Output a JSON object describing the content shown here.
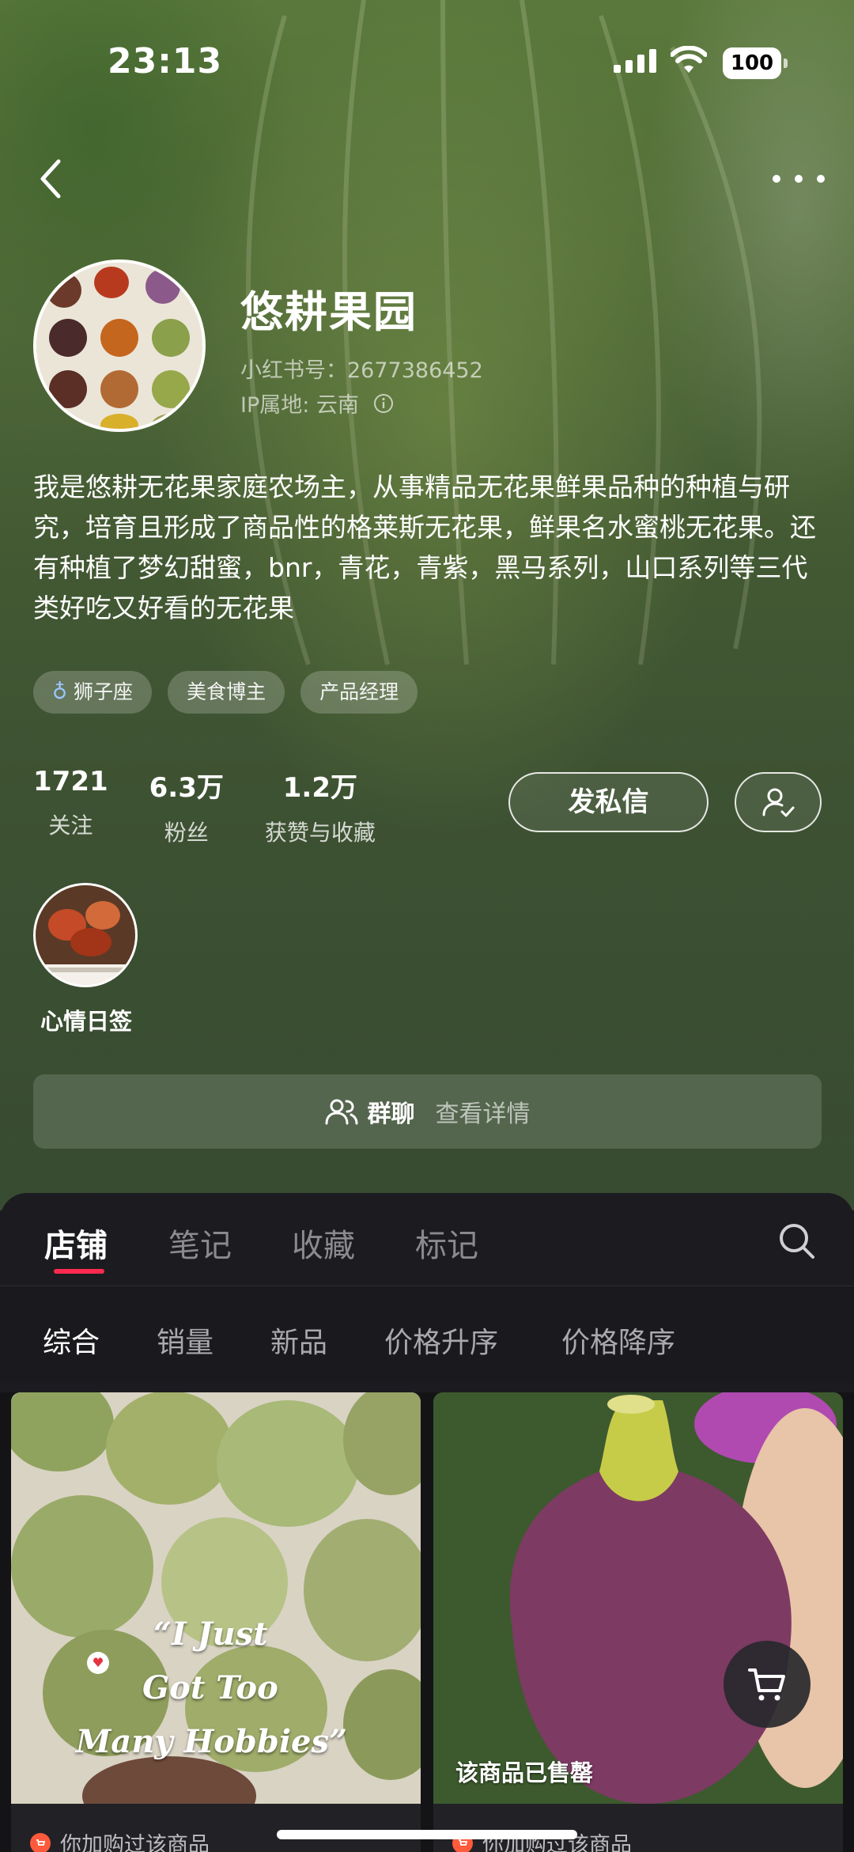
{
  "status_bar": {
    "time": "23:13",
    "battery": "100"
  },
  "profile": {
    "nickname": "悠耕果园",
    "red_id": "小红书号：2677386452",
    "ip_location": "IP属地: 云南",
    "bio": "我是悠耕无花果家庭农场主，从事精品无花果鲜果品种的种植与研究，培育且形成了商品性的格莱斯无花果，鲜果名水蜜桃无花果。还有种植了梦幻甜蜜，bnr，青花，青紫，黑马系列，山口系列等三代类好吃又好看的无花果",
    "tags": [
      {
        "gender_icon": "female-icon",
        "label": "狮子座"
      },
      {
        "label": "美食博主"
      },
      {
        "label": "产品经理"
      }
    ],
    "stats": [
      {
        "value": "1721",
        "label": "关注"
      },
      {
        "value": "6.3万",
        "label": "粉丝"
      },
      {
        "value": "1.2万",
        "label": "获赞与收藏"
      }
    ],
    "message_button": "发私信"
  },
  "highlight": {
    "label": "心情日签"
  },
  "group_chat": {
    "title": "群聊",
    "subtitle": "查看详情"
  },
  "tabs": [
    {
      "label": "店铺",
      "active": true
    },
    {
      "label": "笔记",
      "active": false
    },
    {
      "label": "收藏",
      "active": false
    },
    {
      "label": "标记",
      "active": false
    }
  ],
  "filters": [
    {
      "label": "综合",
      "active": true
    },
    {
      "label": "销量",
      "active": false
    },
    {
      "label": "新品",
      "active": false
    },
    {
      "label": "价格升序",
      "active": false
    },
    {
      "label": "价格降序",
      "active": false
    }
  ],
  "products": [
    {
      "overlay_lines": [
        "“I  Just",
        "Got Too",
        "Many Hobbies”"
      ],
      "meta": "你加购过该商品"
    },
    {
      "sold_label": "该商品已售罄",
      "meta": "你加购过该商品"
    }
  ],
  "colors": {
    "accent": "#ff2a4f",
    "hero_green": "#4f6b3d",
    "panel_dark": "#1c1c20"
  }
}
